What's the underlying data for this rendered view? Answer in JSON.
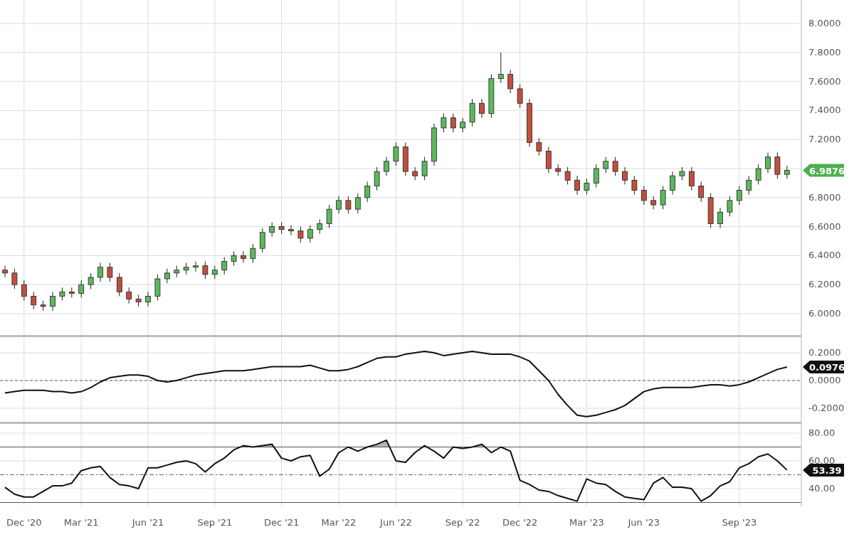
{
  "charts": [
    {
      "chart_data": {
        "type": "candlestick",
        "grid": true,
        "ylim": [
          5.838,
          8.162
        ],
        "yticks": [
          {
            "value": 6,
            "label": "6.0000"
          },
          {
            "value": 6.2,
            "label": "6.2000"
          },
          {
            "value": 6.4,
            "label": "6.4000"
          },
          {
            "value": 6.6,
            "label": "6.6000"
          },
          {
            "value": 6.8,
            "label": "6.8000"
          },
          {
            "value": 7.2,
            "label": "7.2000"
          },
          {
            "value": 7.4,
            "label": "7.4000"
          },
          {
            "value": 7.6,
            "label": "7.6000"
          },
          {
            "value": 7.8,
            "label": "7.8000"
          },
          {
            "value": 8,
            "label": "8.0000"
          }
        ],
        "ohlc": [
          [
            6.3,
            6.33,
            6.25,
            6.28
          ],
          [
            6.28,
            6.31,
            6.17,
            6.2
          ],
          [
            6.2,
            6.23,
            6.09,
            6.12
          ],
          [
            6.12,
            6.15,
            6.03,
            6.06
          ],
          [
            6.06,
            6.09,
            6.02,
            6.05
          ],
          [
            6.05,
            6.15,
            6.02,
            6.12
          ],
          [
            6.12,
            6.18,
            6.09,
            6.15
          ],
          [
            6.15,
            6.18,
            6.11,
            6.14
          ],
          [
            6.14,
            6.23,
            6.11,
            6.2
          ],
          [
            6.2,
            6.28,
            6.17,
            6.25
          ],
          [
            6.25,
            6.35,
            6.22,
            6.32
          ],
          [
            6.32,
            6.35,
            6.22,
            6.25
          ],
          [
            6.25,
            6.28,
            6.12,
            6.15
          ],
          [
            6.15,
            6.18,
            6.07,
            6.1
          ],
          [
            6.1,
            6.13,
            6.05,
            6.08
          ],
          [
            6.08,
            6.15,
            6.05,
            6.12
          ],
          [
            6.12,
            6.27,
            6.09,
            6.24
          ],
          [
            6.24,
            6.31,
            6.21,
            6.28
          ],
          [
            6.28,
            6.33,
            6.25,
            6.3
          ],
          [
            6.3,
            6.35,
            6.27,
            6.32
          ],
          [
            6.32,
            6.36,
            6.29,
            6.33
          ],
          [
            6.33,
            6.36,
            6.24,
            6.27
          ],
          [
            6.27,
            6.33,
            6.24,
            6.3
          ],
          [
            6.3,
            6.39,
            6.27,
            6.36
          ],
          [
            6.36,
            6.43,
            6.33,
            6.4
          ],
          [
            6.4,
            6.43,
            6.35,
            6.38
          ],
          [
            6.38,
            6.48,
            6.35,
            6.45
          ],
          [
            6.45,
            6.59,
            6.42,
            6.56
          ],
          [
            6.56,
            6.63,
            6.53,
            6.6
          ],
          [
            6.6,
            6.63,
            6.55,
            6.58
          ],
          [
            6.58,
            6.61,
            6.54,
            6.57
          ],
          [
            6.57,
            6.6,
            6.49,
            6.52
          ],
          [
            6.52,
            6.61,
            6.49,
            6.58
          ],
          [
            6.58,
            6.65,
            6.55,
            6.62
          ],
          [
            6.62,
            6.75,
            6.59,
            6.72
          ],
          [
            6.72,
            6.81,
            6.69,
            6.78
          ],
          [
            6.78,
            6.81,
            6.69,
            6.72
          ],
          [
            6.72,
            6.83,
            6.69,
            6.8
          ],
          [
            6.8,
            6.91,
            6.77,
            6.88
          ],
          [
            6.88,
            7.01,
            6.85,
            6.98
          ],
          [
            6.98,
            7.08,
            6.95,
            7.05
          ],
          [
            7.05,
            7.18,
            7.02,
            7.15
          ],
          [
            7.15,
            7.18,
            6.95,
            6.98
          ],
          [
            6.98,
            7.01,
            6.92,
            6.95
          ],
          [
            6.95,
            7.08,
            6.92,
            7.05
          ],
          [
            7.05,
            7.31,
            7.02,
            7.28
          ],
          [
            7.28,
            7.38,
            7.25,
            7.35
          ],
          [
            7.35,
            7.38,
            7.25,
            7.28
          ],
          [
            7.28,
            7.35,
            7.25,
            7.32
          ],
          [
            7.32,
            7.48,
            7.29,
            7.45
          ],
          [
            7.45,
            7.48,
            7.35,
            7.38
          ],
          [
            7.38,
            7.65,
            7.35,
            7.62
          ],
          [
            7.62,
            7.8,
            7.59,
            7.65
          ],
          [
            7.65,
            7.68,
            7.52,
            7.55
          ],
          [
            7.55,
            7.58,
            7.42,
            7.45
          ],
          [
            7.45,
            7.48,
            7.15,
            7.18
          ],
          [
            7.18,
            7.21,
            7.09,
            7.12
          ],
          [
            7.12,
            7.15,
            6.97,
            7.0
          ],
          [
            7.0,
            7.03,
            6.95,
            6.98
          ],
          [
            6.98,
            7.01,
            6.89,
            6.92
          ],
          [
            6.92,
            6.95,
            6.82,
            6.85
          ],
          [
            6.85,
            6.93,
            6.82,
            6.9
          ],
          [
            6.9,
            7.03,
            6.87,
            7.0
          ],
          [
            7.0,
            7.08,
            6.97,
            7.05
          ],
          [
            7.05,
            7.08,
            6.95,
            6.98
          ],
          [
            6.98,
            7.01,
            6.89,
            6.92
          ],
          [
            6.92,
            6.95,
            6.82,
            6.85
          ],
          [
            6.85,
            6.88,
            6.75,
            6.78
          ],
          [
            6.78,
            6.81,
            6.72,
            6.75
          ],
          [
            6.75,
            6.88,
            6.72,
            6.85
          ],
          [
            6.85,
            6.98,
            6.82,
            6.95
          ],
          [
            6.95,
            7.01,
            6.92,
            6.98
          ],
          [
            6.98,
            7.01,
            6.85,
            6.88
          ],
          [
            6.88,
            6.91,
            6.77,
            6.8
          ],
          [
            6.8,
            6.83,
            6.59,
            6.62
          ],
          [
            6.62,
            6.73,
            6.59,
            6.7
          ],
          [
            6.7,
            6.81,
            6.67,
            6.78
          ],
          [
            6.78,
            6.88,
            6.75,
            6.85
          ],
          [
            6.85,
            6.95,
            6.82,
            6.92
          ],
          [
            6.92,
            7.03,
            6.89,
            7.0
          ],
          [
            7.0,
            7.11,
            6.97,
            7.08
          ],
          [
            7.08,
            7.11,
            6.93,
            6.96
          ],
          [
            6.96,
            7.02,
            6.93,
            6.9876
          ]
        ]
      },
      "last_label": "6.9876"
    },
    {
      "chart_data": {
        "type": "line",
        "grid": true,
        "ylim": [
          -0.3128,
          0.3128
        ],
        "yticks": [
          {
            "value": -0.2,
            "label": "-0.2000"
          },
          {
            "value": 0,
            "label": "0.0000"
          },
          {
            "value": 0.2,
            "label": "0.2000"
          }
        ],
        "ref_lines": [
          {
            "axis": "y",
            "value": 0
          }
        ],
        "series": [
          {
            "color": "#111111",
            "values": [
              -0.09,
              -0.08,
              -0.07,
              -0.07,
              -0.07,
              -0.08,
              -0.08,
              -0.09,
              -0.08,
              -0.05,
              -0.01,
              0.02,
              0.03,
              0.04,
              0.04,
              0.03,
              0.0,
              -0.01,
              0.0,
              0.02,
              0.04,
              0.05,
              0.06,
              0.07,
              0.07,
              0.07,
              0.08,
              0.09,
              0.1,
              0.1,
              0.1,
              0.1,
              0.11,
              0.09,
              0.07,
              0.07,
              0.08,
              0.1,
              0.13,
              0.16,
              0.17,
              0.17,
              0.19,
              0.2,
              0.21,
              0.2,
              0.18,
              0.19,
              0.2,
              0.21,
              0.2,
              0.19,
              0.19,
              0.19,
              0.17,
              0.14,
              0.07,
              0.0,
              -0.1,
              -0.18,
              -0.25,
              -0.26,
              -0.25,
              -0.23,
              -0.21,
              -0.18,
              -0.13,
              -0.08,
              -0.06,
              -0.05,
              -0.05,
              -0.05,
              -0.05,
              -0.04,
              -0.03,
              -0.03,
              -0.04,
              -0.03,
              -0.01,
              0.02,
              0.05,
              0.08,
              0.0976
            ]
          }
        ]
      },
      "last_label": "0.0976"
    },
    {
      "chart_data": {
        "type": "line",
        "grid": true,
        "ylim": [
          27.18,
          86.67
        ],
        "yticks": [
          {
            "value": 40,
            "label": "40.00"
          },
          {
            "value": 60,
            "label": "60.00"
          },
          {
            "value": 80,
            "label": "80.00"
          }
        ],
        "ref_lines": [
          {
            "axis": "y",
            "value": 70
          },
          {
            "axis": "y",
            "value": 50
          },
          {
            "axis": "y",
            "value": 30
          }
        ],
        "categories": [
          null,
          null,
          "Dec '20",
          null,
          null,
          null,
          null,
          null,
          "Mar '21",
          null,
          null,
          null,
          null,
          null,
          null,
          "Jun '21",
          null,
          null,
          null,
          null,
          null,
          null,
          "Sep '21",
          null,
          null,
          null,
          null,
          null,
          null,
          "Dec '21",
          null,
          null,
          null,
          null,
          null,
          "Mar '22",
          null,
          null,
          null,
          null,
          null,
          "Jun '22",
          null,
          null,
          null,
          null,
          null,
          null,
          "Sep '22",
          null,
          null,
          null,
          null,
          null,
          "Dec '22",
          null,
          null,
          null,
          null,
          null,
          null,
          "Mar '23",
          null,
          null,
          null,
          null,
          null,
          "Jun '23",
          null,
          null,
          null,
          null,
          null,
          null,
          null,
          null,
          null,
          "Sep '23",
          null,
          null,
          null,
          null,
          null
        ],
        "series": [
          {
            "color": "#111111",
            "values": [
              41,
              36,
              34,
              34,
              38,
              42,
              42,
              44,
              53,
              55,
              56,
              48,
              43,
              42,
              40,
              55,
              55,
              57,
              59,
              60,
              58,
              52,
              58,
              62,
              68,
              71,
              70,
              71,
              72,
              62,
              60,
              63,
              64,
              49,
              54,
              66,
              70,
              67,
              70,
              72,
              75,
              60,
              59,
              66,
              71,
              67,
              62,
              70,
              69,
              70,
              72,
              66,
              70,
              67,
              46,
              43,
              39,
              38,
              35,
              33,
              31,
              47,
              44,
              43,
              38,
              34,
              33,
              32,
              44,
              48,
              41,
              41,
              40,
              31,
              35,
              42,
              45,
              55,
              58,
              63,
              65,
              60,
              53.39
            ]
          }
        ]
      },
      "last_label": "53.39"
    }
  ]
}
